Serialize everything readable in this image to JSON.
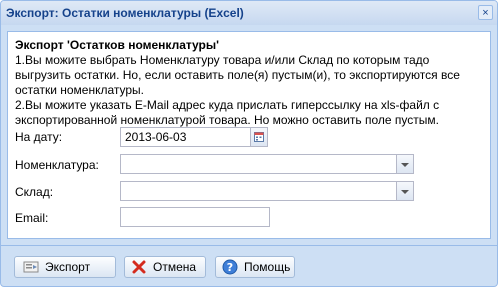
{
  "window": {
    "title": "Экспорт: Остатки номенклатуры (Excel)",
    "close_label": "×"
  },
  "form": {
    "heading": "Экспорт 'Остатков номенклатуры'",
    "description": [
      "1.Вы можите выбрать Номенклатуру товара и/или Склад по которым тадо выгрузить остатки. Но, если оставить поле(я) пустым(и), то экспортируются все остатки номенклатуры.",
      "2.Вы можите указать E-Mail адрес куда прислать гиперссылку на xls-файл с экспортированной номенклатурой товара. Но можно оставить поле пустым."
    ],
    "date": {
      "label": "На дату:",
      "value": "2013-06-03"
    },
    "nomenclature": {
      "label": "Номенклатура:",
      "value": ""
    },
    "warehouse": {
      "label": "Склад:",
      "value": ""
    },
    "email": {
      "label": "Email:",
      "value": ""
    }
  },
  "buttons": {
    "export": "Экспорт",
    "cancel": "Отмена",
    "help": "Помощь"
  },
  "icons": {
    "close": "close-icon",
    "calendar": "calendar-icon",
    "dropdown": "chevron-down-icon",
    "export": "export-icon",
    "cancel": "cancel-icon",
    "help": "help-icon"
  },
  "colors": {
    "title": "#15428b",
    "window_bg": "#cddff4",
    "border": "#99bbe8"
  }
}
